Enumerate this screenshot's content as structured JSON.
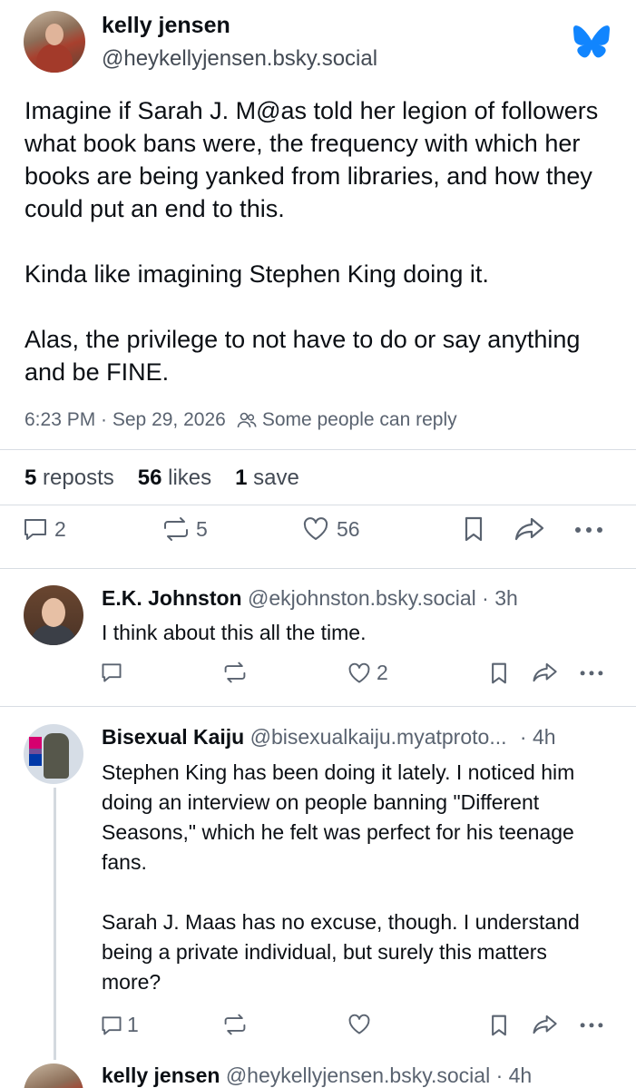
{
  "post": {
    "author_name": "kelly jensen",
    "author_handle": "@heykellyjensen.bsky.social",
    "paragraphs": [
      "Imagine if Sarah J. M@as told her legion of followers what book bans were, the frequency with which her books are being yanked from libraries, and how they could put an end to this.",
      "Kinda like imagining Stephen King doing it.",
      "Alas, the privilege to not have to do or say anything and be FINE."
    ],
    "timestamp": "6:23 PM · Sep 29, 2026",
    "reply_setting": "Some people can reply",
    "stats": {
      "reposts_count": "5",
      "reposts_label": "reposts",
      "likes_count": "56",
      "likes_label": "likes",
      "saves_count": "1",
      "saves_label": "save"
    },
    "actions": {
      "replies": "2",
      "reposts": "5",
      "likes": "56"
    }
  },
  "replies": [
    {
      "author_name": "E.K. Johnston",
      "author_handle": "@ekjohnston.bsky.social",
      "time": "· 3h",
      "paragraphs": [
        "I think about this all the time."
      ],
      "actions": {
        "replies": "",
        "reposts": "",
        "likes": "2"
      }
    },
    {
      "author_name": "Bisexual Kaiju",
      "author_handle": "@bisexualkaiju.myatproto...",
      "time": "· 4h",
      "paragraphs": [
        "Stephen King has been doing it lately. I noticed him doing an interview on people banning \"Different Seasons,\" which he felt was perfect for his teenage fans.",
        "Sarah J. Maas has no excuse, though. I understand being a private individual, but surely this matters more?"
      ],
      "actions": {
        "replies": "1",
        "reposts": "",
        "likes": ""
      }
    },
    {
      "author_name": "kelly jensen",
      "author_handle": "@heykellyjensen.bsky.social",
      "time": "· 4h"
    }
  ],
  "colors": {
    "brand": "#1185fe",
    "text": "#0b0f14",
    "muted": "#5a6370",
    "divider": "#d8dde3"
  },
  "icons": [
    "bluesky-butterfly-icon",
    "people-icon",
    "reply-icon",
    "repost-icon",
    "heart-icon",
    "bookmark-icon",
    "share-icon",
    "more-icon"
  ]
}
